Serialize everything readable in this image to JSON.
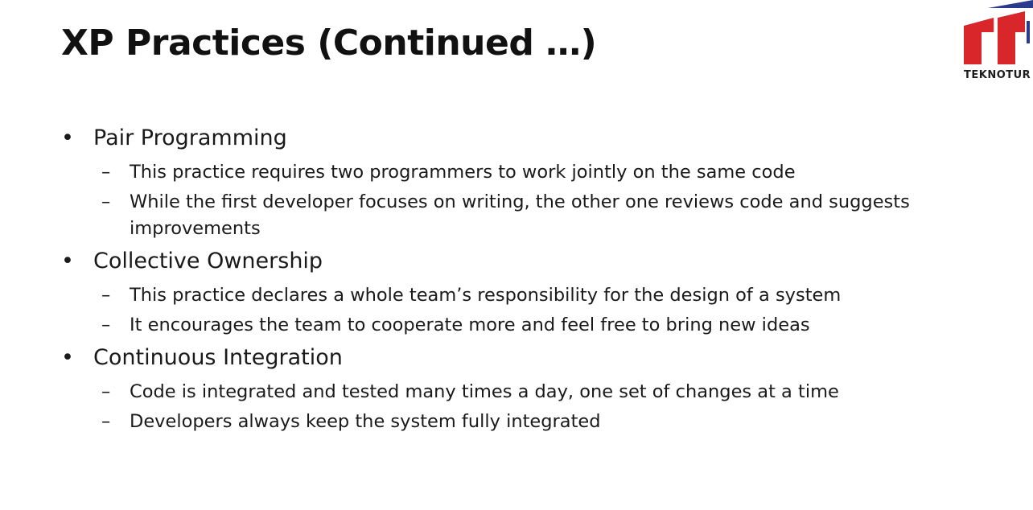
{
  "slide": {
    "title": "XP Practices (Continued …)",
    "logo": {
      "text": "TEKNOTUR",
      "colors": {
        "red": "#d9262b",
        "navy": "#2a3a8c"
      }
    },
    "bullets": [
      {
        "text": "Pair Programming",
        "subs": [
          "This practice requires two programmers to work jointly on the same code",
          "While the first developer focuses on writing, the other one reviews code and suggests improvements"
        ]
      },
      {
        "text": "Collective Ownership",
        "subs": [
          "This practice declares a whole team’s responsibility for the design of a system",
          "It encourages the team to cooperate more and feel free to bring new ideas"
        ]
      },
      {
        "text": "Continuous Integration",
        "subs": [
          "Code is integrated and tested many times a day, one set of changes at a time",
          "Developers always keep the system fully integrated"
        ]
      }
    ]
  }
}
